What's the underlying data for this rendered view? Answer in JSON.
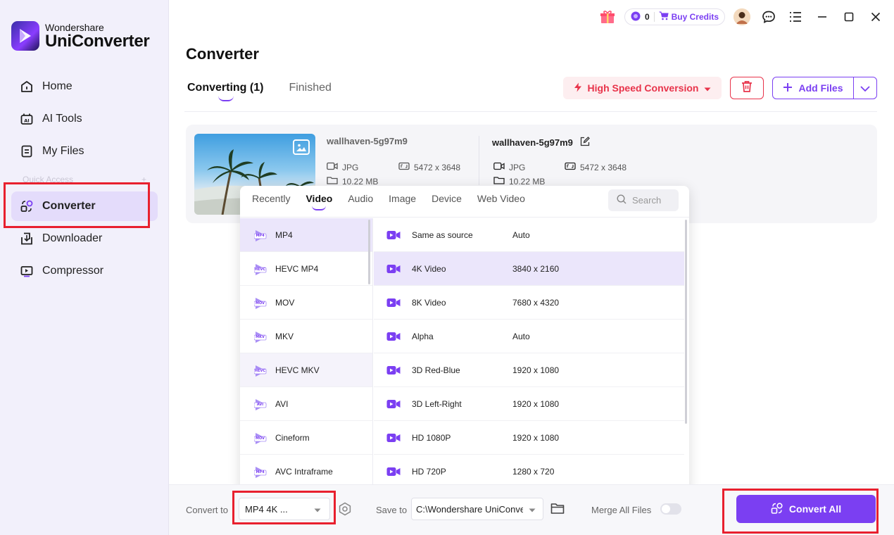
{
  "brand": {
    "top": "Wondershare",
    "bottom": "UniConverter"
  },
  "sidebar": {
    "items": [
      {
        "label": "Home",
        "icon": "home-icon"
      },
      {
        "label": "AI Tools",
        "icon": "ai-tools-icon"
      },
      {
        "label": "My Files",
        "icon": "my-files-icon"
      }
    ],
    "quick_access": "Quick Access",
    "quick_access_add": "+",
    "lower_items": [
      {
        "label": "Converter",
        "icon": "converter-icon",
        "active": true
      },
      {
        "label": "Downloader",
        "icon": "downloader-icon"
      },
      {
        "label": "Compressor",
        "icon": "compressor-icon"
      }
    ]
  },
  "topbar": {
    "credit_count": "0",
    "buy_credits": "Buy Credits"
  },
  "main": {
    "title": "Converter",
    "tabs": [
      {
        "label": "Converting (1)",
        "active": true
      },
      {
        "label": "Finished"
      }
    ],
    "high_speed": "High Speed Conversion",
    "add_files": "Add Files"
  },
  "file": {
    "source": {
      "name": "wallhaven-5g97m9",
      "format": "JPG",
      "resolution": "5472 x 3648",
      "size": "10.22 MB"
    },
    "output": {
      "name": "wallhaven-5g97m9",
      "format": "JPG",
      "resolution": "5472 x 3648",
      "size": "10.22 MB"
    }
  },
  "format_popup": {
    "tabs": [
      "Recently",
      "Video",
      "Audio",
      "Image",
      "Device",
      "Web Video"
    ],
    "active_tab": "Video",
    "search_placeholder": "Search",
    "formats": [
      {
        "label": "MP4",
        "badge": "MP4"
      },
      {
        "label": "HEVC MP4",
        "badge": "HEVC"
      },
      {
        "label": "MOV",
        "badge": "MOV"
      },
      {
        "label": "MKV",
        "badge": "MKV"
      },
      {
        "label": "HEVC MKV",
        "badge": "HEVC"
      },
      {
        "label": "AVI",
        "badge": "AVI"
      },
      {
        "label": "Cineform",
        "badge": "MOV"
      },
      {
        "label": "AVC Intraframe",
        "badge": "MP4"
      }
    ],
    "presets": [
      {
        "name": "Same as source",
        "res": "Auto"
      },
      {
        "name": "4K Video",
        "res": "3840 x 2160"
      },
      {
        "name": "8K Video",
        "res": "7680 x 4320"
      },
      {
        "name": "Alpha",
        "res": "Auto"
      },
      {
        "name": "3D Red-Blue",
        "res": "1920 x 1080"
      },
      {
        "name": "3D Left-Right",
        "res": "1920 x 1080"
      },
      {
        "name": "HD 1080P",
        "res": "1920 x 1080"
      },
      {
        "name": "HD 720P",
        "res": "1280 x 720"
      }
    ]
  },
  "bottom": {
    "convert_to_label": "Convert to",
    "convert_to_value": "MP4 4K ...",
    "save_to_label": "Save to",
    "save_to_value": "C:\\Wondershare UniConverter",
    "merge_label": "Merge All Files",
    "convert_all": "Convert All"
  },
  "colors": {
    "accent": "#7b3ff2",
    "danger": "#e8334a",
    "highlight": "#e8202e"
  }
}
